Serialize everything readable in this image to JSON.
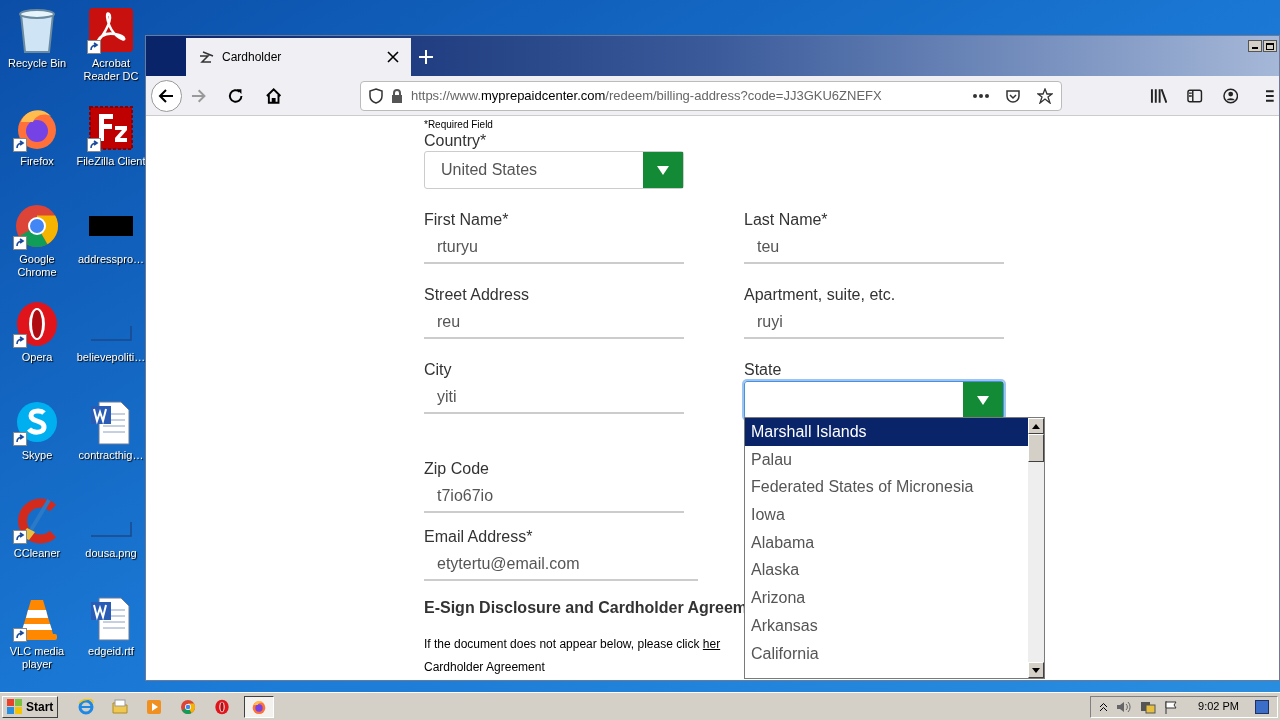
{
  "desktop_icons": [
    {
      "label": "Recycle Bin",
      "kind": "bin",
      "shortcut": false
    },
    {
      "label": "Acrobat Reader DC",
      "kind": "acrobat",
      "shortcut": true
    },
    {
      "label": "Firefox",
      "kind": "firefox",
      "shortcut": true
    },
    {
      "label": "FileZilla Client",
      "kind": "filezilla",
      "shortcut": true
    },
    {
      "label": "Google Chrome",
      "kind": "chrome",
      "shortcut": true
    },
    {
      "label": "addresspro…",
      "kind": "black",
      "shortcut": false
    },
    {
      "label": "Opera",
      "kind": "opera",
      "shortcut": true
    },
    {
      "label": "believepoliti…",
      "kind": "blank",
      "shortcut": false
    },
    {
      "label": "Skype",
      "kind": "skype",
      "shortcut": true
    },
    {
      "label": "contracthig…",
      "kind": "word",
      "shortcut": false
    },
    {
      "label": "CCleaner",
      "kind": "ccleaner",
      "shortcut": true
    },
    {
      "label": "dousa.png",
      "kind": "blank",
      "shortcut": false
    },
    {
      "label": "VLC media player",
      "kind": "vlc",
      "shortcut": true
    },
    {
      "label": "edgeid.rtf",
      "kind": "word",
      "shortcut": false
    }
  ],
  "browser": {
    "tab": {
      "title": "Cardholder",
      "selected": true
    },
    "url": {
      "prefix": "https://www.",
      "domain": "myprepaidcenter.com",
      "path": "/redeem/billing-address?code=JJ3GKU6ZNEFX"
    }
  },
  "form": {
    "required_note": "*Required Field",
    "country": {
      "label": "Country*",
      "value": "United States"
    },
    "fields": [
      {
        "label": "First Name*",
        "value": "rturyu"
      },
      {
        "label": "Last Name*",
        "value": "teu"
      },
      {
        "label": "Street Address",
        "value": "reu"
      },
      {
        "label": "Apartment, suite, etc.",
        "value": "ruyi"
      },
      {
        "label": "City",
        "value": "yiti"
      }
    ],
    "state": {
      "label": "State",
      "focused": true,
      "options": [
        {
          "label": "Marshall Islands",
          "selected": true
        },
        {
          "label": "Palau",
          "selected": false
        },
        {
          "label": "Federated States of Micronesia",
          "selected": false
        },
        {
          "label": "Iowa",
          "selected": false
        },
        {
          "label": "Alabama",
          "selected": false
        },
        {
          "label": "Alaska",
          "selected": false
        },
        {
          "label": "Arizona",
          "selected": false
        },
        {
          "label": "Arkansas",
          "selected": false
        },
        {
          "label": "California",
          "selected": false
        }
      ]
    },
    "zip": {
      "label": "Zip Code",
      "value": "t7io67io"
    },
    "email": {
      "label": "Email Address*",
      "value": "etytertu@email.com"
    },
    "esign_heading": "E-Sign Disclosure and Cardholder Agreem",
    "esign_text": "If the document does not appear below, please click",
    "esign_link": "her",
    "agreement_label": "Cardholder Agreement"
  },
  "taskbar": {
    "start": "Start",
    "apps": [
      {
        "kind": "ie",
        "active": false
      },
      {
        "kind": "folder",
        "active": false
      },
      {
        "kind": "media",
        "active": false
      },
      {
        "kind": "chrome",
        "active": false
      },
      {
        "kind": "opera",
        "active": false
      },
      {
        "kind": "firefox",
        "active": true
      }
    ],
    "time": "9:02 PM"
  }
}
